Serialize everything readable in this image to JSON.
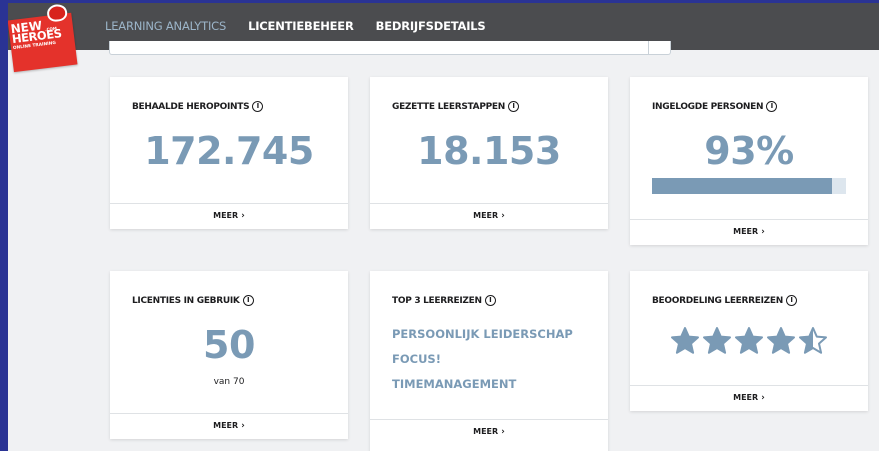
{
  "nav": {
    "items": [
      {
        "label": "LEARNING ANALYTICS",
        "active": true
      },
      {
        "label": "LICENTIEBEHEER",
        "active": false
      },
      {
        "label": "BEDRIJFSDETAILS",
        "active": false
      }
    ]
  },
  "logo": {
    "line1": "NEW",
    "line2": "HEROES",
    "line3": "ONLINE TRAINING",
    "suffix": ".COM"
  },
  "cards": {
    "heropoints": {
      "title": "BEHAALDE HEROPOINTS",
      "value": "172.745",
      "footer": "MEER"
    },
    "leerstappen": {
      "title": "GEZETTE LEERSTAPPEN",
      "value": "18.153",
      "footer": "MEER"
    },
    "ingelogd": {
      "title": "INGELOGDE PERSONEN",
      "value": "93%",
      "progress": 0.93,
      "footer": "MEER"
    },
    "licenties": {
      "title": "LICENTIES IN GEBRUIK",
      "value": "50",
      "sub": "van 70",
      "footer": "MEER"
    },
    "top3": {
      "title": "TOP 3 LEERREIZEN",
      "items": [
        "PERSOONLIJK LEIDERSCHAP",
        "FOCUS!",
        "TIMEMANAGEMENT"
      ],
      "footer": "MEER"
    },
    "beoordeling": {
      "title": "BEOORDELING LEERREIZEN",
      "rating": 4.5,
      "max": 5,
      "footer": "MEER"
    }
  },
  "colors": {
    "accent": "#7a9ab5",
    "topbar": "#4b4c4f",
    "logo": "#e4322b",
    "border": "#2a3394"
  },
  "icons": {
    "info": "info-icon",
    "chevron": "chevron-right-icon",
    "star": "star-icon"
  }
}
